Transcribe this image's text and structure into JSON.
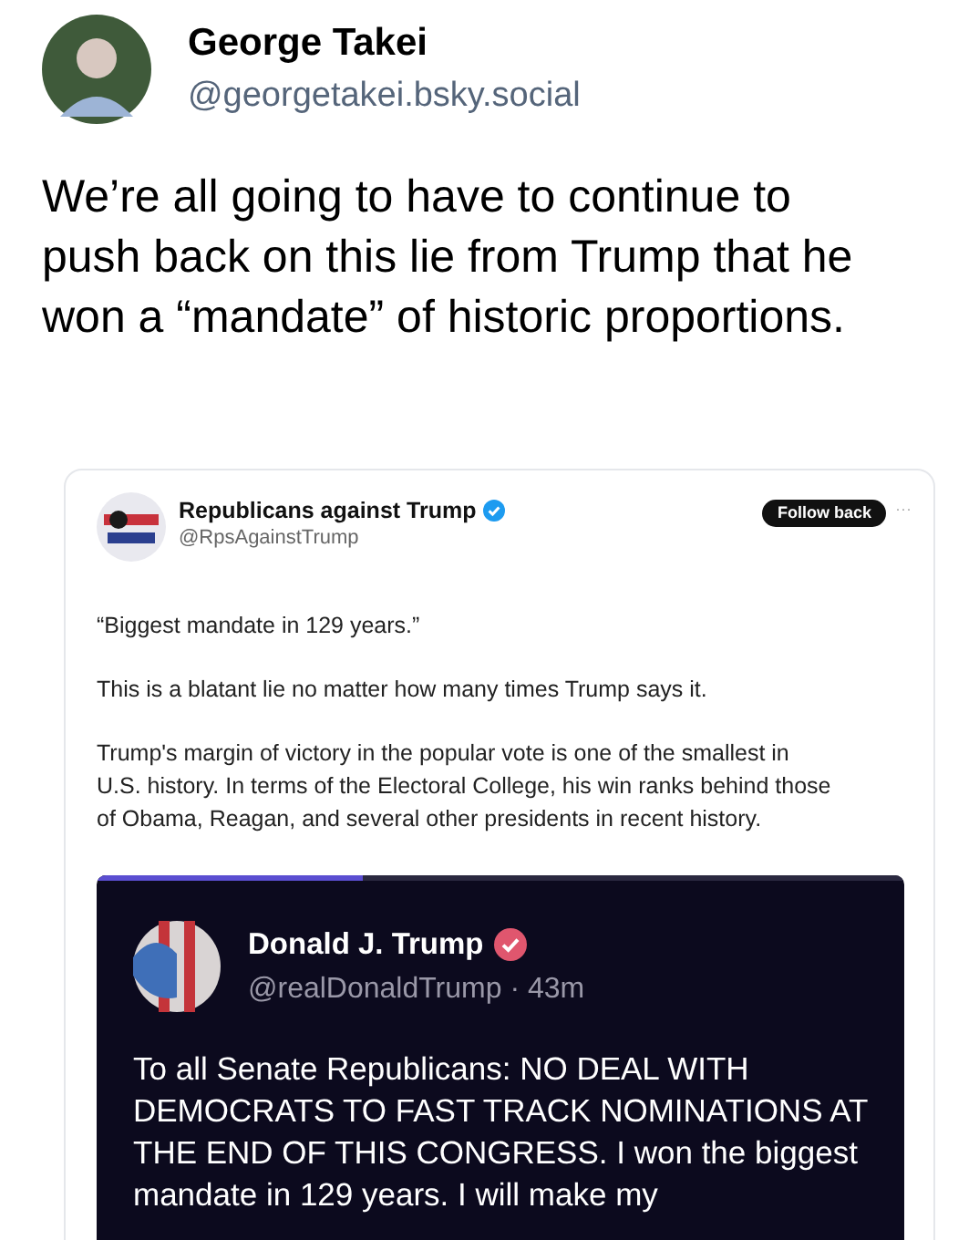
{
  "author": {
    "name": "George Takei",
    "handle": "@georgetakei.bsky.social"
  },
  "post_text": "We’re all going to have to continue to push back on this lie from Trump that he won a “mandate” of historic proportions.",
  "quote": {
    "name": "Republicans against Trump",
    "verified": true,
    "handle": "@RpsAgainstTrump",
    "follow_button": "Follow back",
    "more": "···",
    "paragraphs": [
      "“Biggest mandate in 129 years.”",
      "This is a blatant lie no matter how many times Trump says it.",
      "Trump's margin of victory in the popular vote is one of the smallest in U.S. history. In terms of the Electoral College, his win ranks behind those of Obama, Reagan, and several other presidents in recent history."
    ],
    "story": {
      "progress": {
        "level": 0.33
      },
      "name": "Donald J. Trump",
      "verified": true,
      "handle": "@realDonaldTrump · 43m",
      "text": "To all Senate Republicans: NO DEAL WITH DEMOCRATS TO FAST TRACK NOMINATIONS AT THE END OF THIS CONGRESS. I won the biggest mandate in 129 years. I will make my"
    }
  }
}
